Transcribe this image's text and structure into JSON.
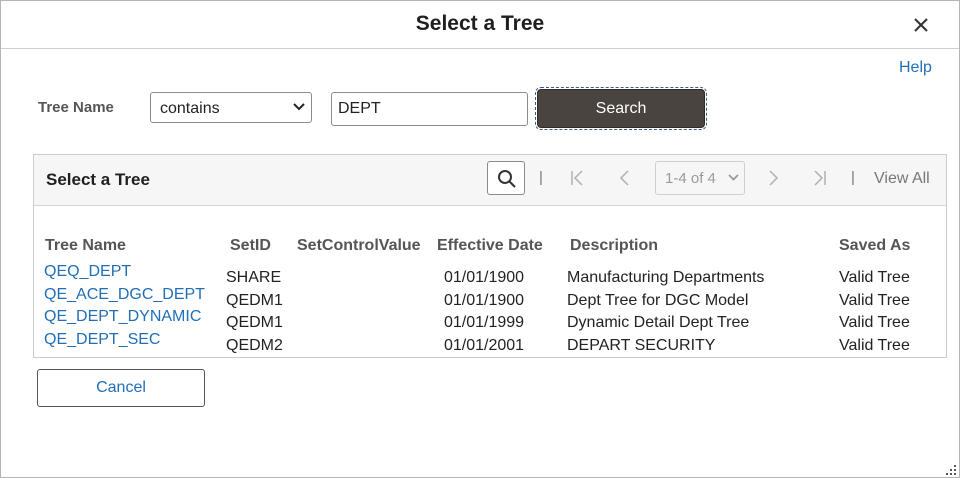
{
  "dialog": {
    "title": "Select a Tree",
    "help_label": "Help",
    "icons": {
      "close": "close-icon",
      "resize": "resize-grip-icon"
    }
  },
  "search": {
    "field_label": "Tree Name",
    "operator_selected": "contains",
    "value": "DEPT",
    "button_label": "Search"
  },
  "grid": {
    "title": "Select a Tree",
    "pager_text": "1-4 of 4",
    "view_all_label": "View All",
    "separator": "|",
    "icons": [
      "search-icon",
      "first-page-icon",
      "previous-page-icon",
      "next-page-icon",
      "last-page-icon"
    ],
    "columns": [
      "Tree Name",
      "SetID",
      "SetControlValue",
      "Effective Date",
      "Description",
      "Saved As"
    ],
    "rows": [
      {
        "tree_name": "QEQ_DEPT",
        "setid": "SHARE",
        "setcontrolvalue": "",
        "effective_date": "01/01/1900",
        "description": "Manufacturing Departments",
        "saved_as": "Valid Tree"
      },
      {
        "tree_name": "QE_ACE_DGC_DEPT",
        "setid": "QEDM1",
        "setcontrolvalue": "",
        "effective_date": "01/01/1900",
        "description": "Dept Tree for DGC Model",
        "saved_as": "Valid Tree"
      },
      {
        "tree_name": "QE_DEPT_DYNAMIC",
        "setid": "QEDM1",
        "setcontrolvalue": "",
        "effective_date": "01/01/1999",
        "description": "Dynamic Detail Dept Tree",
        "saved_as": "Valid Tree"
      },
      {
        "tree_name": "QE_DEPT_SEC",
        "setid": "QEDM2",
        "setcontrolvalue": "",
        "effective_date": "01/01/2001",
        "description": "DEPART SECURITY",
        "saved_as": "Valid Tree"
      }
    ]
  },
  "footer": {
    "cancel_label": "Cancel"
  },
  "colors": {
    "link": "#1f6eb6",
    "primary_button": "#4a4440",
    "text": "#333333"
  }
}
